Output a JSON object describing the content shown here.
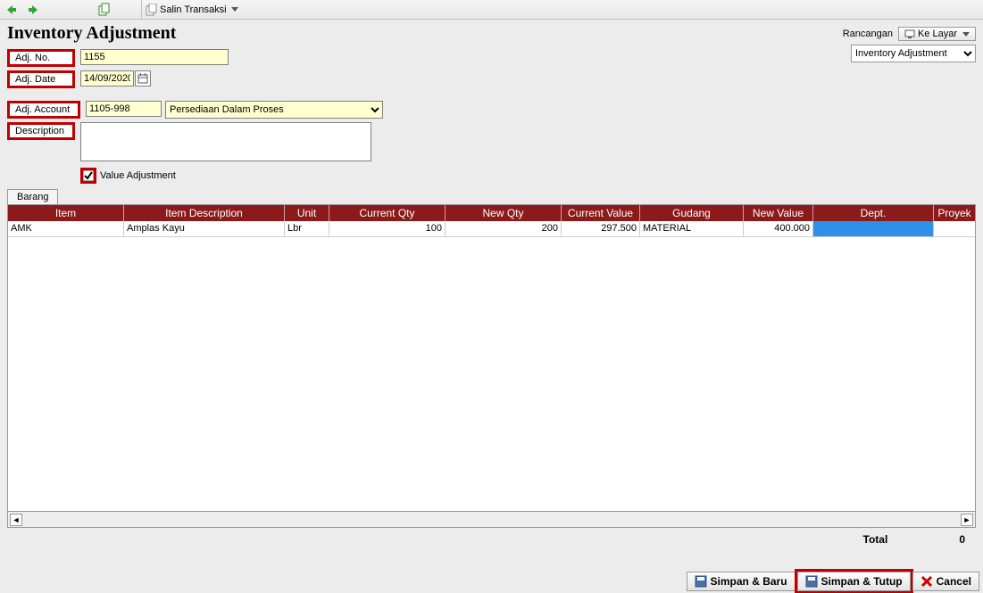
{
  "toolbar": {
    "salin_label": "Salin Transaksi"
  },
  "page_title": "Inventory Adjustment",
  "labels": {
    "adj_no": "Adj. No.",
    "adj_date": "Adj. Date",
    "adj_account": "Adj. Account",
    "description": "Description",
    "value_adjustment": "Value Adjustment",
    "rancangan": "Rancangan",
    "ke_layar": "Ke Layar",
    "total": "Total"
  },
  "form": {
    "adj_no": "1155",
    "adj_date": "14/09/2020",
    "adj_account": "1105-998",
    "adj_account_name": "Persediaan Dalam Proses",
    "description": "",
    "value_adjustment_checked": true,
    "template_select": "Inventory Adjustment"
  },
  "tab": {
    "barang": "Barang"
  },
  "grid": {
    "columns": [
      "Item",
      "Item Description",
      "Unit",
      "Current Qty",
      "New Qty",
      "Current Value",
      "Gudang",
      "New Value",
      "Dept.",
      "Proyek"
    ],
    "rows": [
      {
        "item": "AMK",
        "desc": "Amplas Kayu",
        "unit": "Lbr",
        "cqty": "100",
        "nqty": "200",
        "cval": "297.500",
        "gudang": "MATERIAL",
        "nval": "400.000",
        "dept": "",
        "proyek": ""
      }
    ]
  },
  "total_value": "0",
  "buttons": {
    "simpan_baru": "Simpan & Baru",
    "simpan_tutup": "Simpan & Tutup",
    "cancel": "Cancel"
  }
}
